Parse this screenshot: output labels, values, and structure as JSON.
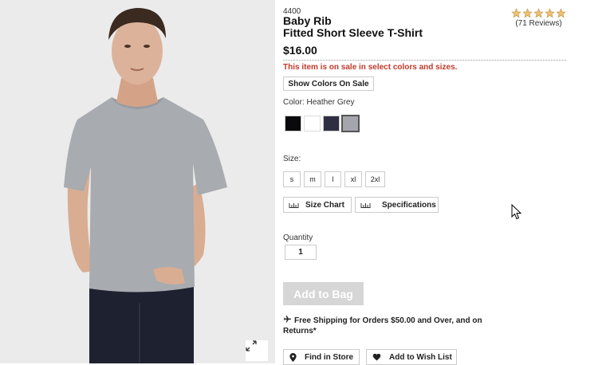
{
  "product": {
    "sku": "4400",
    "title_line1": "Baby Rib",
    "title_line2": "Fitted Short Sleeve T-Shirt",
    "price": "$16.00",
    "rating_stars": 5,
    "reviews": "(71 Reviews)",
    "sale_note": "This item is on sale in select colors and sizes."
  },
  "buttons": {
    "show_colors": "Show Colors On Sale",
    "size_chart": "Size Chart",
    "specifications": "Specifications",
    "add_to_bag": "Add to Bag",
    "find_in_store": "Find in Store",
    "wish_list": "Add to Wish List"
  },
  "color": {
    "label": "Color:",
    "selected": "Heather Grey",
    "swatches": [
      {
        "name": "Black",
        "hex": "#0a0a0c"
      },
      {
        "name": "White",
        "hex": "#ffffff"
      },
      {
        "name": "Navy",
        "hex": "#2f2f44"
      },
      {
        "name": "Heather Grey",
        "hex": "#a5a5ad"
      }
    ]
  },
  "size": {
    "label": "Size:",
    "options": [
      "s",
      "m",
      "l",
      "xl",
      "2xl"
    ]
  },
  "quantity": {
    "label": "Quantity",
    "value": "1"
  },
  "shipping": {
    "text": "Free Shipping for Orders $50.00 and Over, and on Returns*"
  },
  "icons": {
    "zoom": "expand-icon",
    "ruler": "ruler-icon",
    "plane": "airplane-icon",
    "pin": "map-pin-icon",
    "heart": "heart-icon",
    "star": "star-icon"
  },
  "colors": {
    "sale_red": "#c0392b",
    "star_fill": "#f0c070"
  }
}
